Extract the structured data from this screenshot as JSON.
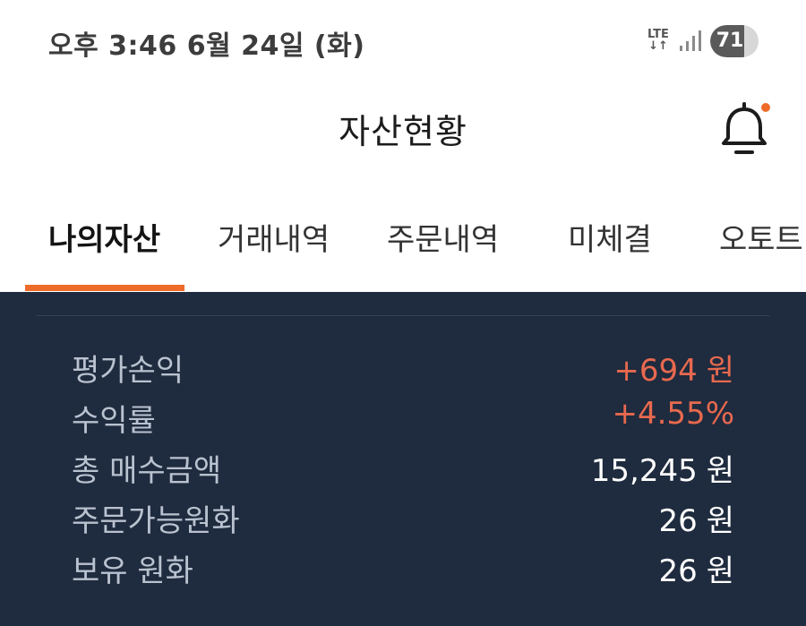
{
  "status_bar": {
    "time": "오후 3:46  6월 24일 (화)",
    "network": "LTE",
    "network_arrows": "↓↑",
    "battery_level": "71",
    "battery_fraction": 0.71
  },
  "header": {
    "title": "자산현황",
    "notification_icon": "bell-icon",
    "notification_dot_color": "#ee6b2a"
  },
  "tabs": [
    {
      "label": "나의자산",
      "active": true
    },
    {
      "label": "거래내역",
      "active": false
    },
    {
      "label": "주문내역",
      "active": false
    },
    {
      "label": "미체결",
      "active": false
    },
    {
      "label": "오토트",
      "active": false
    }
  ],
  "summary": {
    "rows": [
      {
        "label": "평가손익",
        "value": "+694",
        "unit": "원"
      },
      {
        "label": "수익률",
        "value": "+4.55%",
        "unit": ""
      },
      {
        "label": "총 매수금액",
        "value": "15,245",
        "unit": "원"
      },
      {
        "label": "주문가능원화",
        "value": "26",
        "unit": "원"
      },
      {
        "label": "보유 원화",
        "value": "26",
        "unit": "원"
      }
    ]
  },
  "colors": {
    "accent": "#ee6b2a",
    "panel_background": "#1f2b3e",
    "positive": "#e8694f"
  }
}
